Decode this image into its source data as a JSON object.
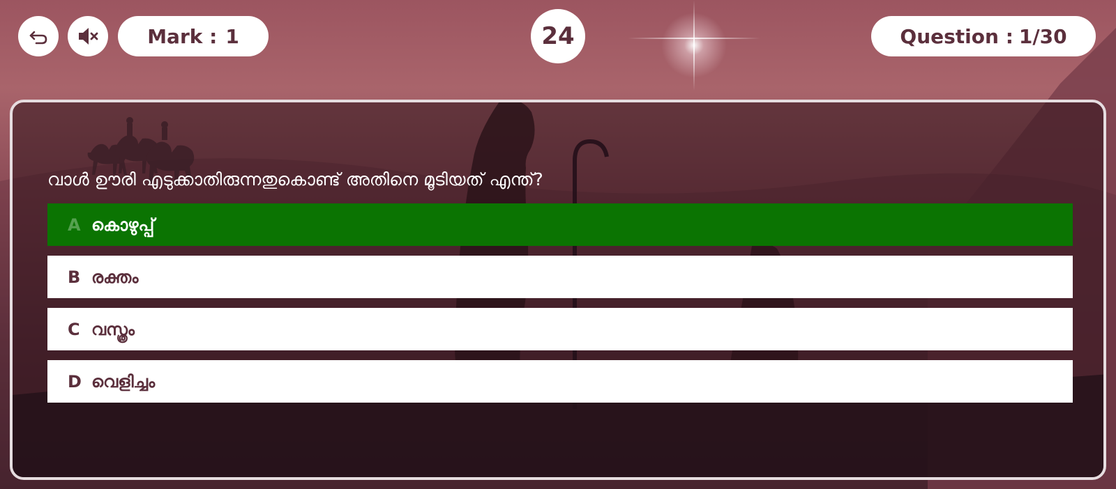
{
  "header": {
    "back_icon": "back-arrow-icon",
    "mute_icon": "speaker-muted-icon",
    "mark_label": "Mark :",
    "mark_value": "1",
    "timer": "24",
    "question_label": "Question :",
    "question_counter": "1/30"
  },
  "quiz": {
    "question": "വാൾ ഊരി എടുക്കാതിരുന്നതുകൊണ്ട് അതിനെ മൂടിയത് എന്ത്?",
    "options": [
      {
        "letter": "A",
        "text": "കൊഴുപ്പ്",
        "state": "correct"
      },
      {
        "letter": "B",
        "text": "രക്തം",
        "state": "normal"
      },
      {
        "letter": "C",
        "text": "വസ്ത്രം",
        "state": "normal"
      },
      {
        "letter": "D",
        "text": "വെളിച്ചം",
        "state": "normal"
      }
    ]
  },
  "colors": {
    "accent_text": "#5b2f3c",
    "correct_green": "#0b7402",
    "panel_border": "#e6dde0"
  }
}
